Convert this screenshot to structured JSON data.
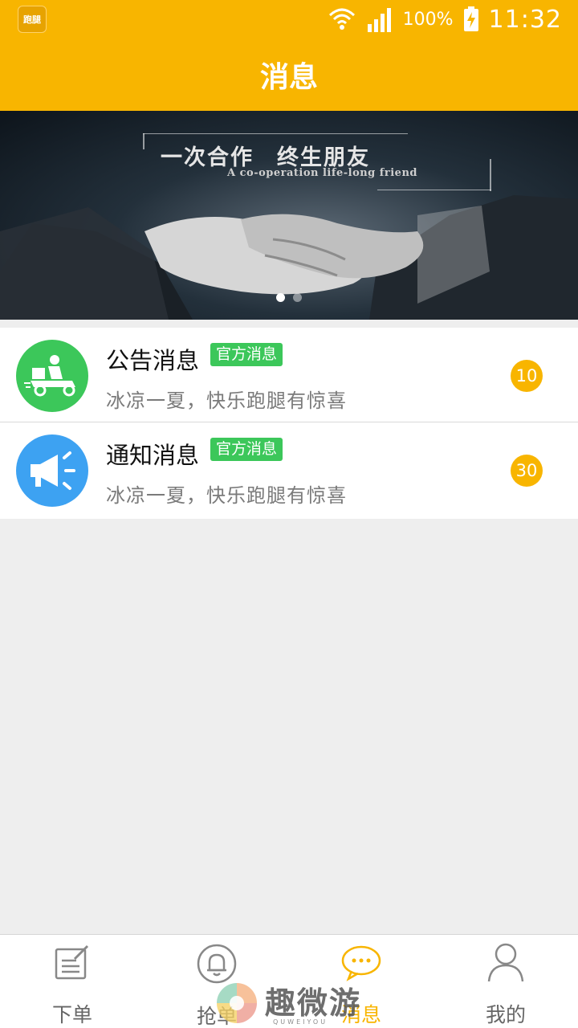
{
  "status_bar": {
    "app_icon_label": "跑腿",
    "battery": "100%",
    "time": "11:32"
  },
  "header": {
    "title": "消息"
  },
  "banner": {
    "title": "一次合作　终生朋友",
    "subtitle": "A co-operation life-long friend",
    "page_count": 2,
    "active_page": 1
  },
  "messages": [
    {
      "title": "公告消息",
      "tag": "官方消息",
      "preview": "冰凉一夏，快乐跑腿有惊喜",
      "badge": "10",
      "icon": "delivery-rider-icon",
      "color": "#3cc75a"
    },
    {
      "title": "通知消息",
      "tag": "官方消息",
      "preview": "冰凉一夏，快乐跑腿有惊喜",
      "badge": "30",
      "icon": "megaphone-icon",
      "color": "#3da2f2"
    }
  ],
  "tabbar": {
    "tabs": [
      {
        "label": "下单",
        "icon": "edit-icon",
        "active": false
      },
      {
        "label": "抢单",
        "icon": "bell-icon",
        "active": false
      },
      {
        "label": "消息",
        "icon": "chat-icon",
        "active": true
      },
      {
        "label": "我的",
        "icon": "user-icon",
        "active": false
      }
    ]
  },
  "watermark": {
    "text": "趣微游",
    "sub": "QUWEIYOU"
  },
  "colors": {
    "accent": "#f8b500",
    "green": "#3cc75a",
    "blue": "#3da2f2"
  }
}
